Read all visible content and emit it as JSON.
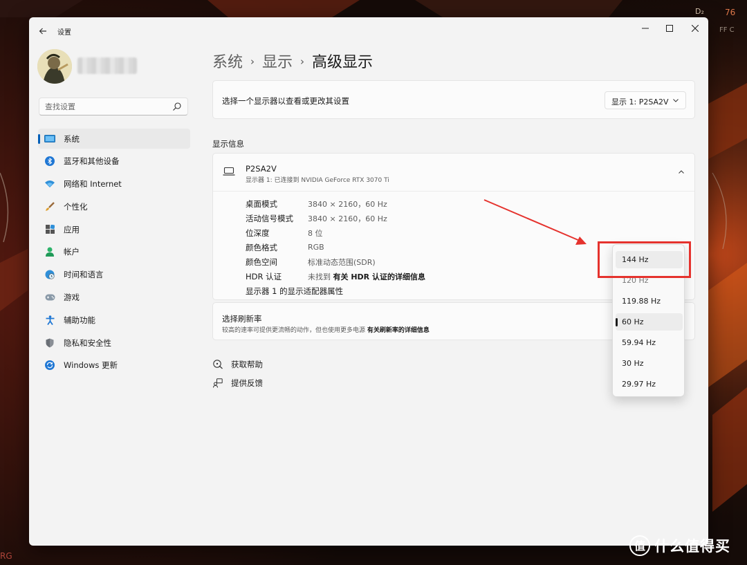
{
  "window": {
    "app_title": "设置",
    "back_label": "←",
    "controls": {
      "minimize": "—",
      "maximize": "☐",
      "close": "✕"
    }
  },
  "search": {
    "placeholder": "查找设置"
  },
  "sidebar": {
    "items": [
      {
        "label": "系统",
        "icon": "system-icon",
        "active": true
      },
      {
        "label": "蓝牙和其他设备",
        "icon": "bluetooth-icon"
      },
      {
        "label": "网络和 Internet",
        "icon": "wifi-icon"
      },
      {
        "label": "个性化",
        "icon": "brush-icon"
      },
      {
        "label": "应用",
        "icon": "apps-icon"
      },
      {
        "label": "帐户",
        "icon": "account-icon"
      },
      {
        "label": "时间和语言",
        "icon": "globe-clock-icon"
      },
      {
        "label": "游戏",
        "icon": "gamepad-icon"
      },
      {
        "label": "辅助功能",
        "icon": "accessibility-icon"
      },
      {
        "label": "隐私和安全性",
        "icon": "shield-icon"
      },
      {
        "label": "Windows 更新",
        "icon": "update-icon"
      }
    ]
  },
  "breadcrumb": {
    "level1": "系统",
    "level2": "显示",
    "current": "高级显示",
    "sep": "›"
  },
  "display_selector": {
    "label": "选择一个显示器以查看或更改其设置",
    "selected": "显示 1: P2SA2V"
  },
  "display_info": {
    "section_title": "显示信息",
    "monitor_name": "P2SA2V",
    "monitor_sub": "显示器 1: 已连接到 NVIDIA GeForce RTX 3070 Ti",
    "rows": [
      {
        "key": "桌面模式",
        "value": "3840 × 2160，60 Hz"
      },
      {
        "key": "活动信号模式",
        "value": "3840 × 2160，60 Hz"
      },
      {
        "key": "位深度",
        "value": "8 位"
      },
      {
        "key": "颜色格式",
        "value": "RGB"
      },
      {
        "key": "颜色空间",
        "value": "标准动态范围(SDR)"
      },
      {
        "key": "HDR 认证",
        "value_prefix": "未找到 ",
        "value_link": "有关 HDR 认证的详细信息"
      }
    ],
    "adapter_link": "显示器 1 的显示适配器属性"
  },
  "refresh_rate": {
    "title": "选择刷新率",
    "desc": "较高的速率可提供更流畅的动作，但也使用更多电源  ",
    "desc_link": "有关刷新率的详细信息",
    "options": [
      "144 Hz",
      "120 Hz",
      "119.88 Hz",
      "60 Hz",
      "59.94 Hz",
      "30 Hz",
      "29.97 Hz"
    ],
    "selected": "60 Hz",
    "hovered": "144 Hz"
  },
  "help": {
    "get_help": "获取帮助",
    "feedback": "提供反馈"
  },
  "watermark": {
    "text": "什么值得买",
    "logo": "值"
  },
  "colors": {
    "accent": "#005fb8",
    "annotation": "#e5322d"
  }
}
